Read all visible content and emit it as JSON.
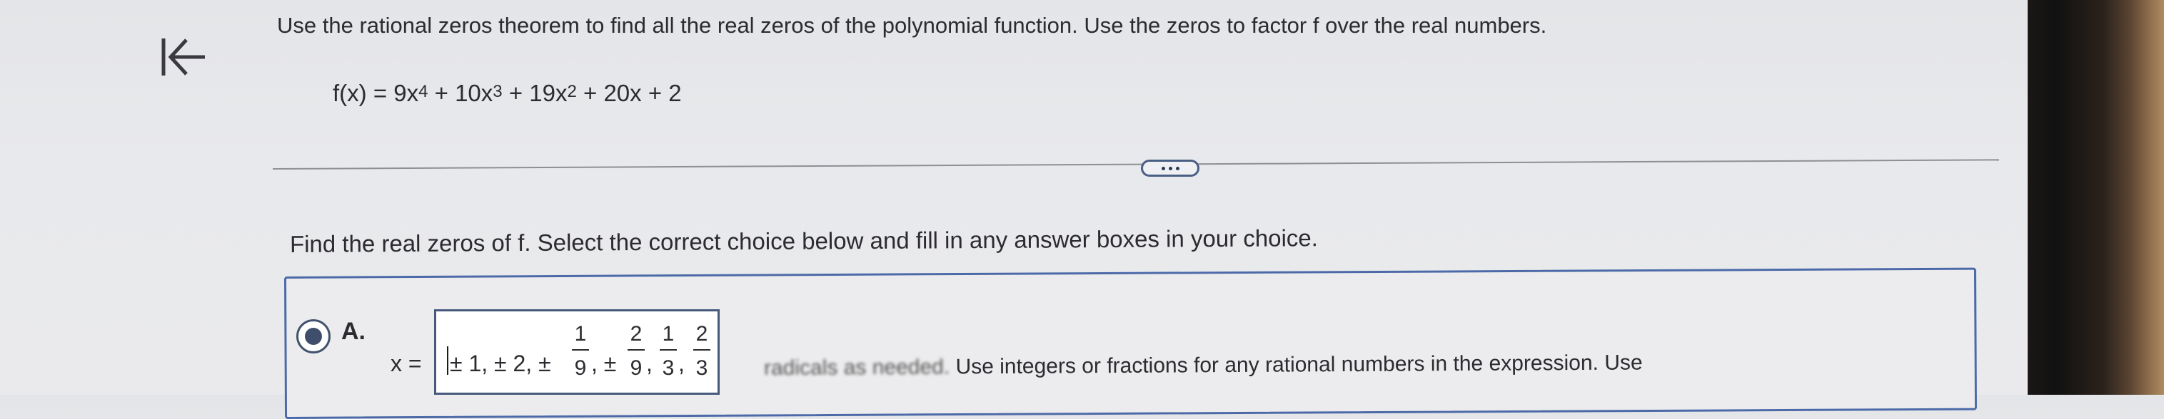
{
  "nav": {
    "collapse_icon": "collapse-left-icon"
  },
  "question": {
    "prompt": "Use the rational zeros theorem to find all the real zeros of the polynomial function. Use the zeros to factor f over the real numbers.",
    "function_lhs": "f(x) = 9x",
    "exp4": "4",
    "term2": " + 10x",
    "exp3": "3",
    "term3": " + 19x",
    "exp2": "2",
    "term4": " + 20x + 2"
  },
  "more_button": {
    "icon": "ellipsis-icon"
  },
  "part": {
    "instruction": "Find the real zeros of f. Select the correct choice below and fill in any answer boxes in your choice."
  },
  "choice_a": {
    "label": "A.",
    "selected": true,
    "x_equals": "x =",
    "answer": {
      "lead": "± 1, ± 2, ±",
      "f1_num": "1",
      "f1_den": "9",
      "sep1": ", ±",
      "f2_num": "2",
      "f2_den": "9",
      "f3_num": "1",
      "f3_den": "3",
      "f4_num": "2",
      "f4_den": "3",
      "comma": ","
    },
    "helper_partial": "radicals as needed.",
    "helper_text": "Use integers or fractions for any rational numbers in the expression. Use"
  },
  "colors": {
    "accent_border": "#4d6aa8",
    "radio": "#3f4f6b"
  }
}
